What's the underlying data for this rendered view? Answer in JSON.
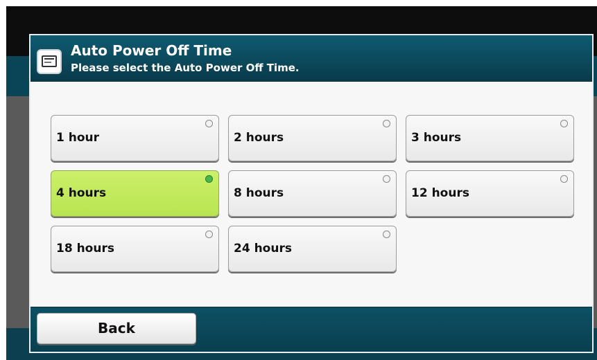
{
  "dialog": {
    "title": "Auto Power Off Time",
    "subtitle": "Please select the Auto Power Off Time.",
    "icon": "panel-screen-icon"
  },
  "options": [
    {
      "label": "1 hour",
      "selected": false
    },
    {
      "label": "2 hours",
      "selected": false
    },
    {
      "label": "3 hours",
      "selected": false
    },
    {
      "label": "4 hours",
      "selected": true
    },
    {
      "label": "8 hours",
      "selected": false
    },
    {
      "label": "12 hours",
      "selected": false
    },
    {
      "label": "18 hours",
      "selected": false
    },
    {
      "label": "24 hours",
      "selected": false
    }
  ],
  "footer": {
    "back_label": "Back"
  },
  "colors": {
    "header": "#0a4557",
    "selected": "#c4ec5f",
    "selected_indicator": "#46b84a",
    "panel": "#f7f7f7"
  }
}
